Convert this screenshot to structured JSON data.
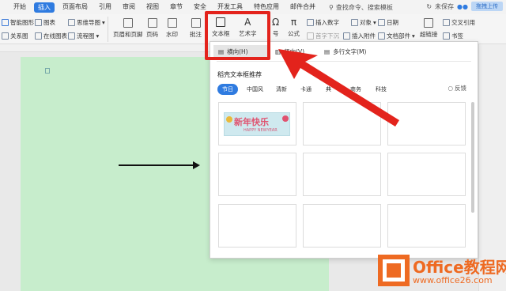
{
  "menubar": {
    "items": [
      "开始",
      "插入",
      "页面布局",
      "引用",
      "审阅",
      "视图",
      "章节",
      "安全",
      "开发工具",
      "特色应用",
      "邮件合并"
    ],
    "active_index": 1,
    "search_placeholder": "查找命令、搜索模板",
    "unsaved": "未保存",
    "cloud_button": "拖拽上传"
  },
  "ribbon": {
    "smart_shape": "智能图形",
    "chart": "图表",
    "mind_map": "思维导图",
    "relation_map": "关系图",
    "online_chart": "在线图表",
    "flow_chart": "流程图",
    "header_footer": "页眉和页脚",
    "page_number": "页码",
    "watermark": "水印",
    "comment": "批注",
    "textbox": "文本框",
    "wordart": "艺术字",
    "symbol": "号",
    "formula": "公式",
    "insert_number": "插入数字",
    "object": "对象",
    "date": "日期",
    "first_drop": "首字下沉",
    "attachment": "插入附件",
    "document_parts": "文档部件",
    "hyperlink": "超链接",
    "cross_reference": "交叉引用",
    "bookmark": "书签"
  },
  "dropdown": {
    "options": [
      "横向(H)",
      "竖向(V)",
      "多行文字(M)"
    ],
    "title": "稻壳文本框推荐",
    "categories": [
      "节日",
      "中国风",
      "清新",
      "卡通",
      "典",
      "商务",
      "科技"
    ],
    "active_category": 0,
    "feedback": "反馈",
    "template_title": "新年快乐",
    "template_subtitle": "HAPPY NEWYEAR"
  },
  "logo": {
    "brand": "Office教程网",
    "url": "www.office26.com"
  },
  "colors": {
    "accent": "#2f7be0",
    "highlight_red": "#e3231c",
    "page_green": "#c7edcc",
    "logo_orange": "#ee6a22"
  }
}
